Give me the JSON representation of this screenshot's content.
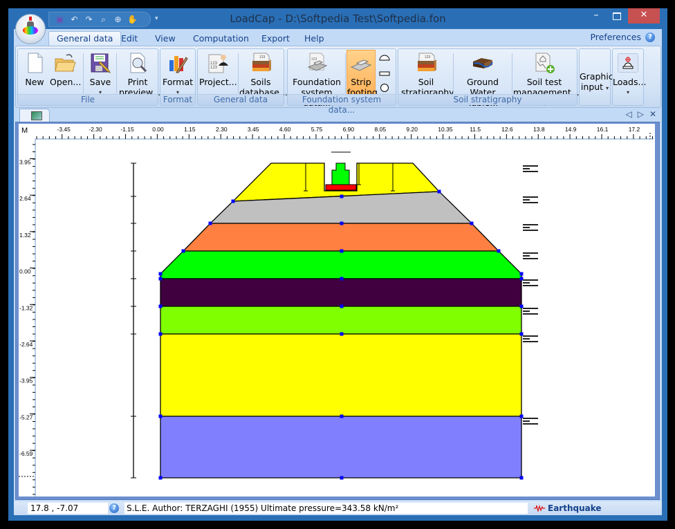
{
  "window": {
    "title": "LoadCap  - D:\\Softpedia Test\\Softpedia.fon",
    "minimize_glyph": "–",
    "close_glyph": "✕"
  },
  "quick_access": [
    {
      "name": "save-icon",
      "glyph": "▣"
    },
    {
      "name": "undo-icon",
      "glyph": "↶"
    },
    {
      "name": "redo-icon",
      "glyph": "↷"
    },
    {
      "name": "zoom-icon",
      "glyph": "⌕"
    },
    {
      "name": "zoom-page-icon",
      "glyph": "⊕"
    },
    {
      "name": "pan-hand-icon",
      "glyph": "✋"
    }
  ],
  "qat_more": "▾",
  "menu_tabs": [
    "General data",
    "Edit",
    "View",
    "Computation",
    "Export",
    "Help"
  ],
  "active_tab": "General data",
  "preferences": {
    "label": "Preferences",
    "help_glyph": "?"
  },
  "ribbon": {
    "groups": {
      "file": "File",
      "format": "Format",
      "general_data": "General data",
      "foundation": "Foundation system data...",
      "soil": "Soil stratigraphy"
    },
    "buttons": {
      "new": "New",
      "open": "Open...",
      "save": "Save",
      "print_line1": "Print",
      "print_line2": "preview...",
      "format": "Format",
      "project": "Project...",
      "soils_line1": "Soils",
      "soils_line2": "database...",
      "foundation_line1": "Foundation",
      "foundation_line2": "system data...",
      "strip_line1": "Strip",
      "strip_line2": "footing",
      "soil_strat_line1": "Soil",
      "soil_strat_line2": "stratigraphy",
      "gwt_line1": "Ground Water",
      "gwt_line2": "Table...",
      "soiltest_line1": "Soil test",
      "soiltest_line2": "management...",
      "graphic_line1": "Graphic",
      "graphic_line2": "input",
      "loads": "Loads..."
    },
    "caret": "▾",
    "footing_shapes": [
      "strip-arch",
      "rectangle",
      "circle"
    ]
  },
  "doc_nav": {
    "prev": "◁",
    "next": "▷",
    "close": "✕"
  },
  "ruler": {
    "unit": "M",
    "x_ticks": [
      "-3.45",
      "-2.30",
      "-1.15",
      "0.00",
      "1.15",
      "2.30",
      "3.45",
      "4.60",
      "5.75",
      "6.90",
      "8.05",
      "9.20",
      "10.35",
      "11.5",
      "12.6",
      "13.8",
      "14.9",
      "16.1",
      "17.2"
    ],
    "y_ticks": [
      "3.95",
      "2.64",
      "1.32",
      "0.00",
      "-1.32",
      "-2.64",
      "-3.95",
      "-5.27",
      "-6.59"
    ]
  },
  "drawing": {
    "layers": [
      {
        "name": "fill-top",
        "color": "#ffff00"
      },
      {
        "name": "layer-gray",
        "color": "#c0c0c0"
      },
      {
        "name": "layer-orange",
        "color": "#ff8040"
      },
      {
        "name": "layer-green",
        "color": "#00ff00"
      },
      {
        "name": "layer-dark-purple",
        "color": "#400040"
      },
      {
        "name": "layer-lime",
        "color": "#80ff00"
      },
      {
        "name": "layer-yellow",
        "color": "#ffff00"
      },
      {
        "name": "layer-blue",
        "color": "#8080ff"
      }
    ],
    "footing_color": "#ff0000",
    "column_color": "#00ff00",
    "handle_color": "#0000ff"
  },
  "status": {
    "coords": "17.8 , -7.07",
    "message": "S.L.E. Author: TERZAGHI (1955) Ultimate pressure=343.58 kN/m²",
    "earthquake": "Earthquake",
    "help_glyph": "?"
  }
}
